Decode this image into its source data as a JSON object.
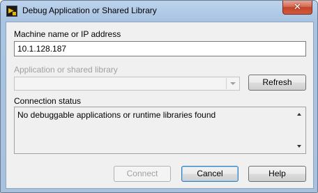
{
  "window": {
    "title": "Debug Application or Shared Library",
    "icon": "labview-app-icon",
    "close_glyph": "✕"
  },
  "machine": {
    "label": "Machine name or IP address",
    "value": "10.1.128.187"
  },
  "application": {
    "label": "Application or shared library",
    "value": "",
    "enabled": false
  },
  "buttons": {
    "refresh": "Refresh",
    "connect": "Connect",
    "cancel": "Cancel",
    "help": "Help"
  },
  "status": {
    "label": "Connection status",
    "message": "No debuggable applications or runtime libraries found"
  }
}
